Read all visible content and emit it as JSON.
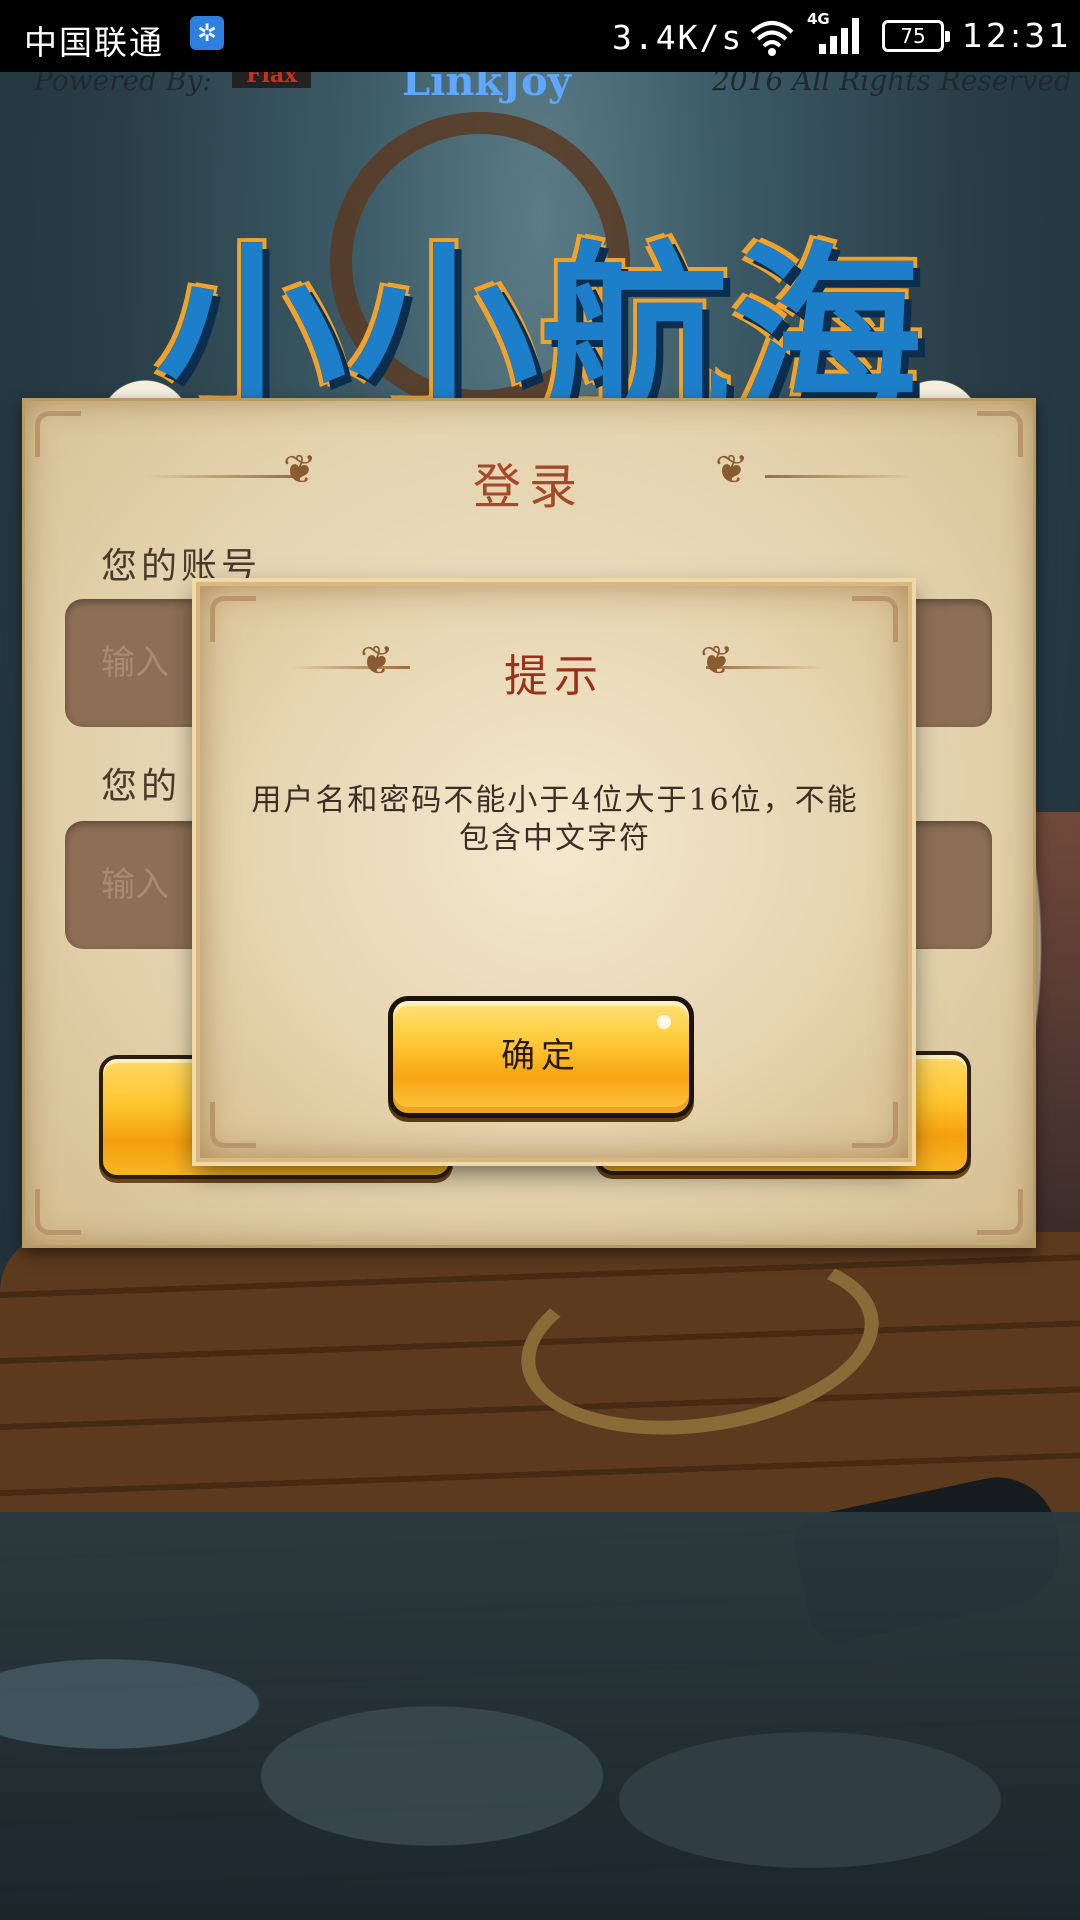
{
  "status_bar": {
    "carrier": "中国联通",
    "app_icon": "✲",
    "net_speed": "3.4K/s",
    "network_type": "4G",
    "battery": "75",
    "time": "12:31"
  },
  "background": {
    "powered_by": "Powered By:",
    "engine": "Flax",
    "publisher": "LinkJoy",
    "rights": "2016 All Rights Reserved",
    "game_title": "小小航海士"
  },
  "login": {
    "title": "登录",
    "account_label": "您的账号",
    "account_placeholder": "输入",
    "password_label": "您的",
    "password_placeholder": "输入"
  },
  "dialog": {
    "title": "提示",
    "message": "用户名和密码不能小于4位大于16位，不能包含中文字符",
    "confirm_label": "确定"
  }
}
